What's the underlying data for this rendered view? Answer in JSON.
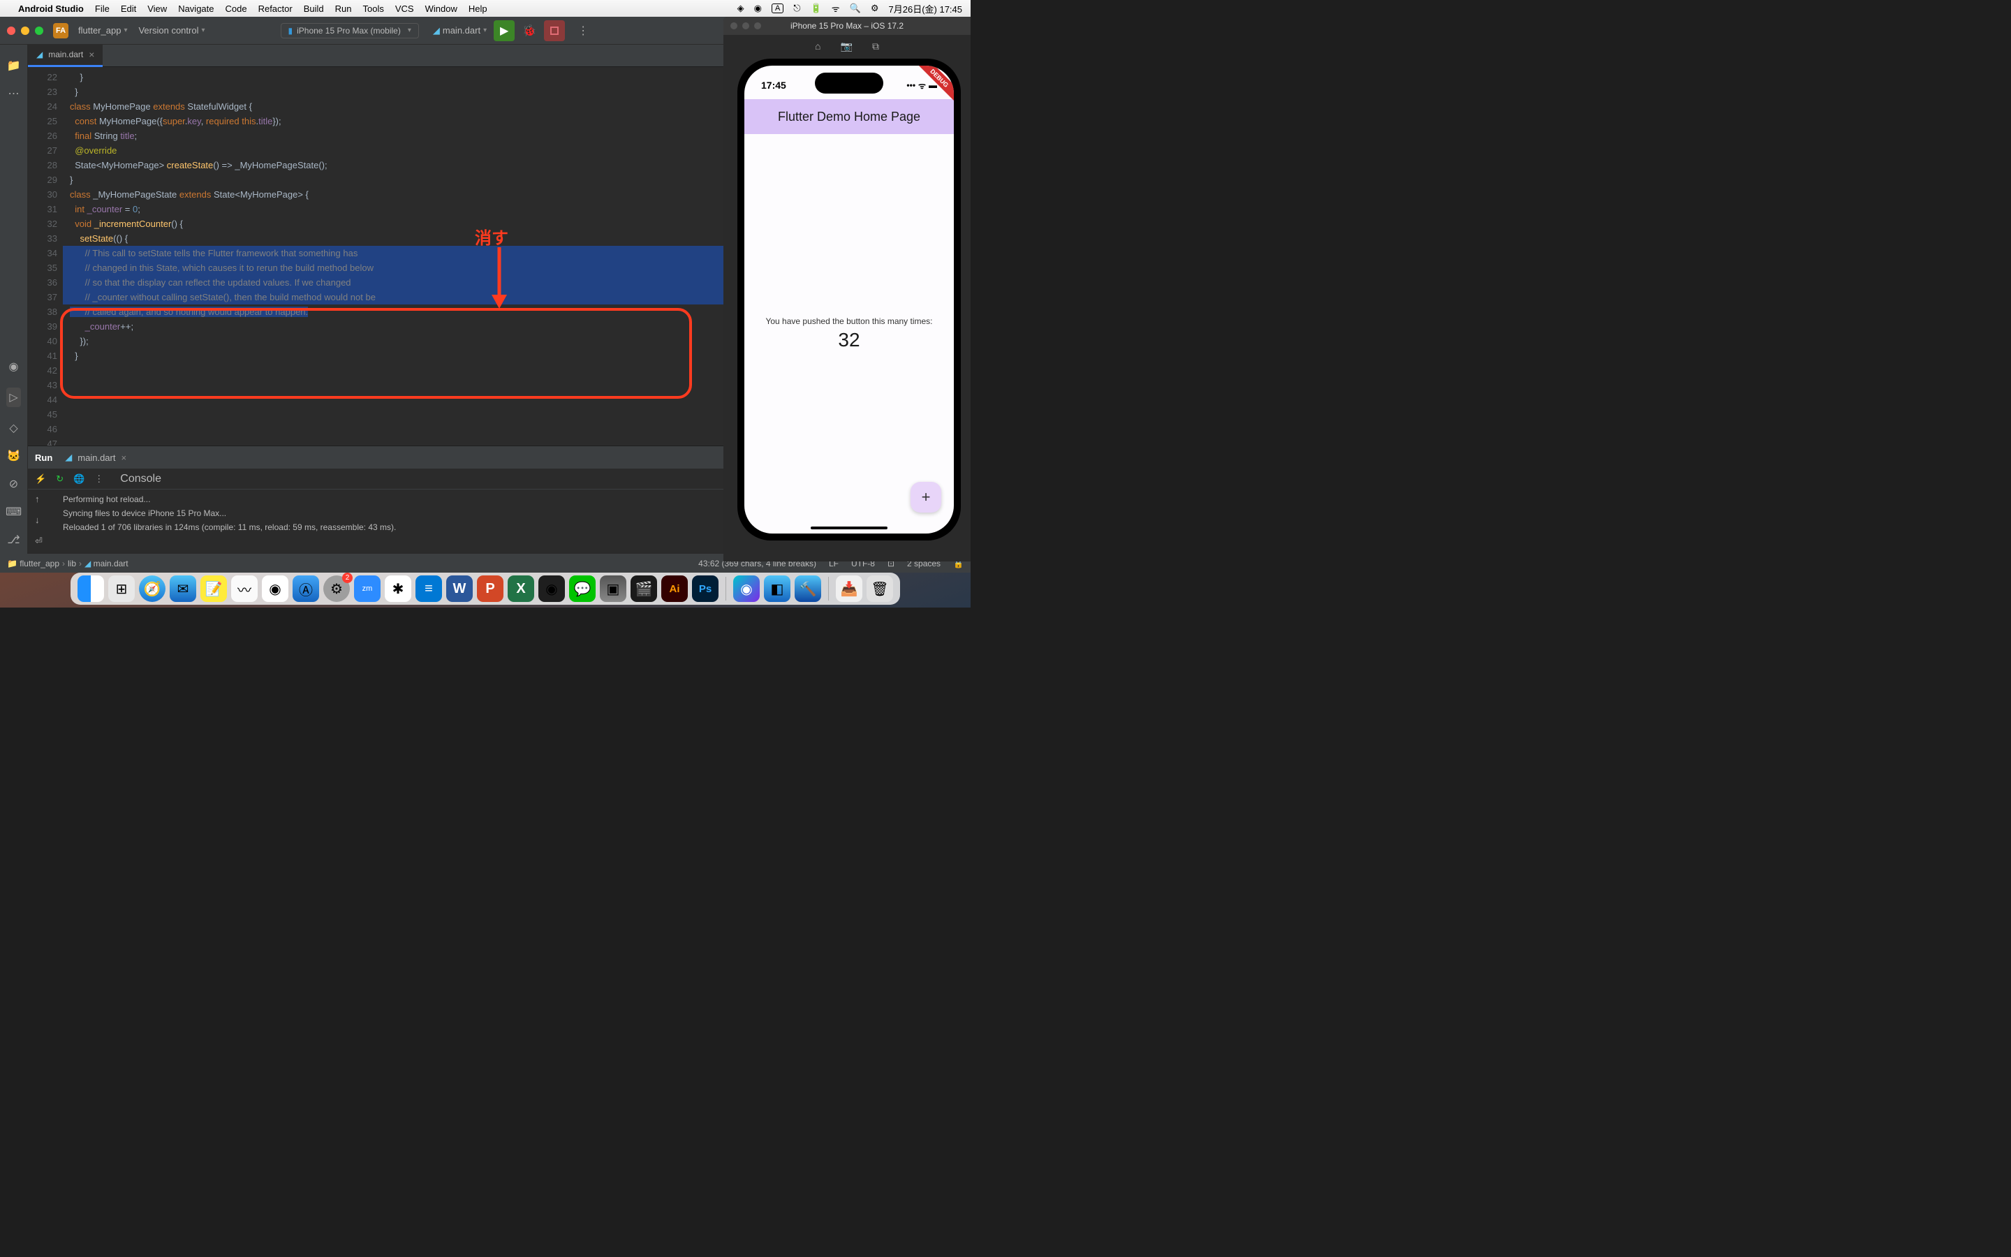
{
  "menubar": {
    "app": "Android Studio",
    "items": [
      "File",
      "Edit",
      "View",
      "Navigate",
      "Code",
      "Refactor",
      "Build",
      "Run",
      "Tools",
      "VCS",
      "Window",
      "Help"
    ],
    "clock": "7月26日(金) 17:45",
    "input_indicator": "A"
  },
  "toolbar": {
    "project_badge": "FA",
    "project_name": "flutter_app",
    "vcs": "Version control",
    "device": "iPhone 15 Pro Max (mobile)",
    "run_config": "main.dart"
  },
  "editor": {
    "tab": "main.dart",
    "gutter_start": 22,
    "lines": [
      "    }",
      "  }",
      "",
      "class MyHomePage extends StatefulWidget {",
      "  const MyHomePage({super.key, required this.title});",
      "",
      "  final String title;",
      "",
      "  @override",
      "  State<MyHomePage> createState() => _MyHomePageState();",
      "}",
      "",
      "class _MyHomePageState extends State<MyHomePage> {",
      "  int _counter = 0;",
      "",
      "  void _incrementCounter() {",
      "    setState(() {",
      "      // This call to setState tells the Flutter framework that something has",
      "      // changed in this State, which causes it to rerun the build method below",
      "      // so that the display can reflect the updated values. If we changed",
      "      // _counter without calling setState(), then the build method would not be",
      "      // called again, and so nothing would appear to happen.",
      "      _counter++;",
      "    });",
      "  }",
      ""
    ]
  },
  "annotation": {
    "text": "消す"
  },
  "run_panel": {
    "label": "Run",
    "file": "main.dart",
    "console_label": "Console",
    "output": [
      "Performing hot reload...",
      "Syncing files to device iPhone 15 Pro Max...",
      "Reloaded 1 of 706 libraries in 124ms (compile: 11 ms, reload: 59 ms, reassemble: 43 ms)."
    ]
  },
  "statusbar": {
    "breadcrumbs": [
      "flutter_app",
      "lib",
      "main.dart"
    ],
    "cursor": "43:62 (369 chars, 4 line breaks)",
    "line_sep": "LF",
    "encoding": "UTF-8",
    "indent": "2 spaces"
  },
  "simulator": {
    "title": "iPhone 15 Pro Max – iOS 17.2",
    "time": "17:45",
    "appbar": "Flutter Demo Home Page",
    "message": "You have pushed the button this many times:",
    "count": "32",
    "debug": "DEBUG"
  },
  "dock": {
    "settings_badge": "2"
  }
}
